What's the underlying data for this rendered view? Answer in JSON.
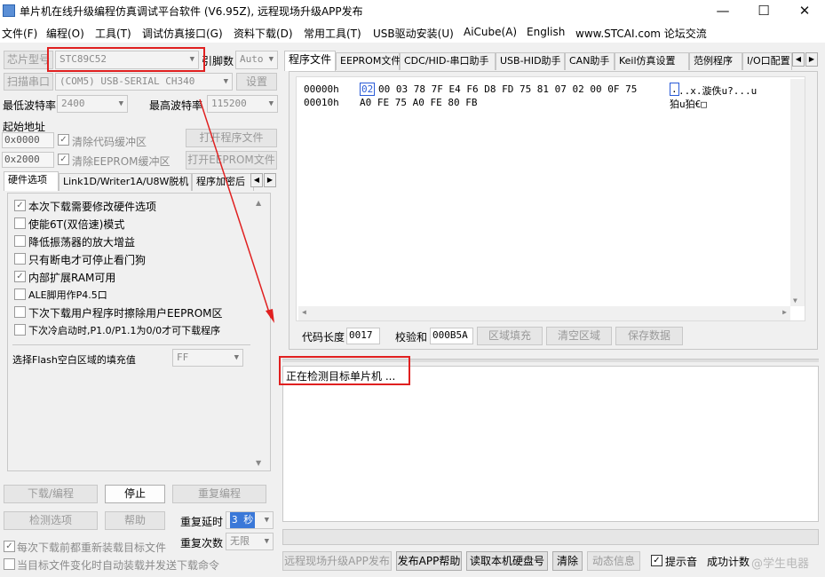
{
  "window": {
    "title": "单片机在线升级编程仿真调试平台软件 (V6.95Z), 远程现场升级APP发布",
    "minimize": "—",
    "maximize": "☐",
    "close": "✕"
  },
  "menu": [
    "文件(F)",
    "编程(O)",
    "工具(T)",
    "调试仿真接口(G)",
    "资料下载(D)",
    "常用工具(T)",
    "USB驱动安装(U)",
    "AiCube(A)",
    "English",
    "www.STCAI.com 论坛交流"
  ],
  "left": {
    "chip_label": "芯片型号",
    "chip_value": "STC89C52",
    "pins_label": "引脚数",
    "pins_value": "Auto",
    "scan_port": "扫描串口",
    "port_value": "(COM5) USB-SERIAL CH340",
    "settings": "设置",
    "min_baud_label": "最低波特率",
    "min_baud_value": "2400",
    "max_baud_label": "最高波特率",
    "max_baud_value": "115200",
    "start_addr_label": "起始地址",
    "addr1": "0x0000",
    "clear_code": "清除代码缓冲区",
    "open_prog": "打开程序文件",
    "addr2": "0x2000",
    "clear_eeprom": "清除EEPROM缓冲区",
    "open_eeprom": "打开EEPROM文件",
    "tabs": [
      "硬件选项",
      "Link1D/Writer1A/U8W脱机",
      "程序加密后"
    ],
    "options": [
      {
        "label": "本次下载需要修改硬件选项",
        "checked": true
      },
      {
        "label": "使能6T(双倍速)模式",
        "checked": false
      },
      {
        "label": "降低振荡器的放大增益",
        "checked": false
      },
      {
        "label": "只有断电才可停止看门狗",
        "checked": false
      },
      {
        "label": "内部扩展RAM可用",
        "checked": true
      },
      {
        "label": "ALE脚用作P4.5口",
        "checked": false
      },
      {
        "label": "下次下载用户程序时擦除用户EEPROM区",
        "checked": false
      },
      {
        "label": "下次冷启动时,P1.0/P1.1为0/0才可下载程序",
        "checked": false
      }
    ],
    "fill_label": "选择Flash空白区域的填充值",
    "fill_value": "FF",
    "download": "下载/编程",
    "stop": "停止",
    "reprogram": "重复编程",
    "detect": "检测选项",
    "help": "帮助",
    "repeat_delay_label": "重复延时",
    "repeat_delay_value": "3 秒",
    "repeat_count_label": "重复次数",
    "repeat_count_value": "无限",
    "reload_each": "每次下载前都重新装载目标文件",
    "auto_reload": "当目标文件变化时自动装载并发送下载命令"
  },
  "right": {
    "tabs": [
      "程序文件",
      "EEPROM文件",
      "CDC/HID-串口助手",
      "USB-HID助手",
      "CAN助手",
      "Keil仿真设置",
      "范例程序",
      "I/O口配置"
    ],
    "hex_rows": [
      {
        "addr": "00000h",
        "first": "02",
        "bytes": "00 03 78 7F E4 F6 D8 FD 75 81 07 02 00 0F 75",
        "ascii_first": ".",
        "ascii": "..x.漩佚u?...u"
      },
      {
        "addr": "00010h",
        "first": "",
        "bytes": "A0 FE 75 A0 FE 80 FB",
        "ascii_first": "",
        "ascii": "狛u狛€□"
      }
    ],
    "code_len_label": "代码长度",
    "code_len": "0017",
    "checksum_label": "校验和",
    "checksum": "000B5A",
    "fill_area": "区域填充",
    "clear_area": "清空区域",
    "save_data": "保存数据",
    "status_text": "正在检测目标单片机 ..."
  },
  "bottom": {
    "publish_remote": "远程现场升级APP发布",
    "publish_help": "发布APP帮助",
    "read_disk": "读取本机硬盘号",
    "clear": "清除",
    "anim": "动态信息",
    "tone_label": "提示音",
    "success_count_label": "成功计数",
    "watermark": "@学生电器"
  }
}
